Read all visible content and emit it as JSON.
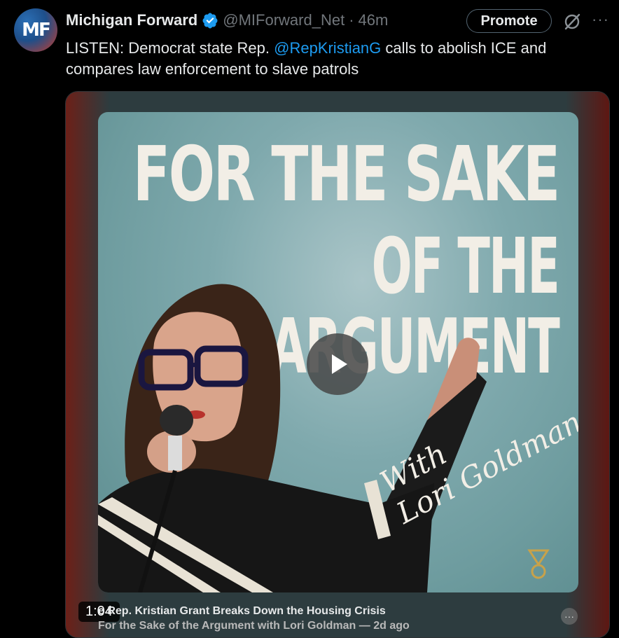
{
  "tweet": {
    "avatar_text": "MF",
    "display_name": "Michigan Forward",
    "handle": "@MIForward_Net",
    "separator": "·",
    "time": "46m",
    "text_before": "LISTEN: Democrat state Rep. ",
    "mention": "@RepKristianG",
    "text_after": " calls to abolish ICE and compares law enforcement to slave patrols"
  },
  "actions": {
    "promote_label": "Promote",
    "more_label": "···"
  },
  "media": {
    "artwork_title_line1": "FOR THE SAKE",
    "artwork_title_line2": "OF THE",
    "artwork_title_line3": "ARGUMENT",
    "artwork_script_line1": "With",
    "artwork_script_line2": "Lori Goldman",
    "duration": "1:04",
    "episode_title": "e Rep. Kristian Grant Breaks Down the Housing Crisis",
    "episode_subtitle": "For the Sake of the Argument with Lori Goldman — 2d ago",
    "more_label": "···"
  },
  "colors": {
    "accent": "#1d9bf0",
    "background": "#000000",
    "text_primary": "#e7e9ea",
    "text_secondary": "#71767b"
  }
}
